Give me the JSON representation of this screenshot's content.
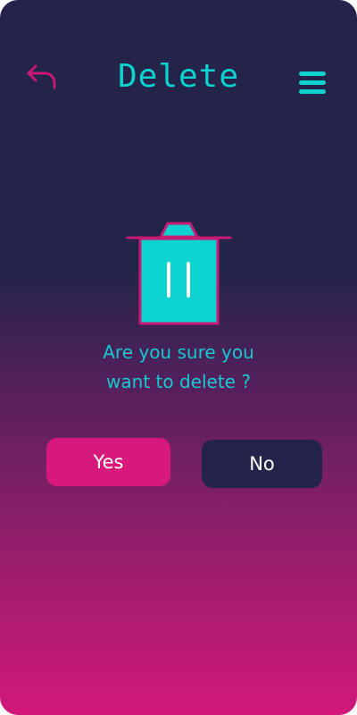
{
  "header": {
    "title": "Delete",
    "back_icon": "back-arrow-icon",
    "menu_icon": "hamburger-menu-icon"
  },
  "dialog": {
    "icon": "trash-bin-icon",
    "question_line1": "Are you sure you",
    "question_line2": "want to delete ?",
    "yes_label": "Yes",
    "no_label": "No"
  },
  "colors": {
    "background_top": "#24244a",
    "background_bottom": "#d3187a",
    "accent_cyan": "#0dd3d0",
    "accent_pink": "#d7187c",
    "no_button": "#24244a",
    "text_white": "#ffffff"
  }
}
